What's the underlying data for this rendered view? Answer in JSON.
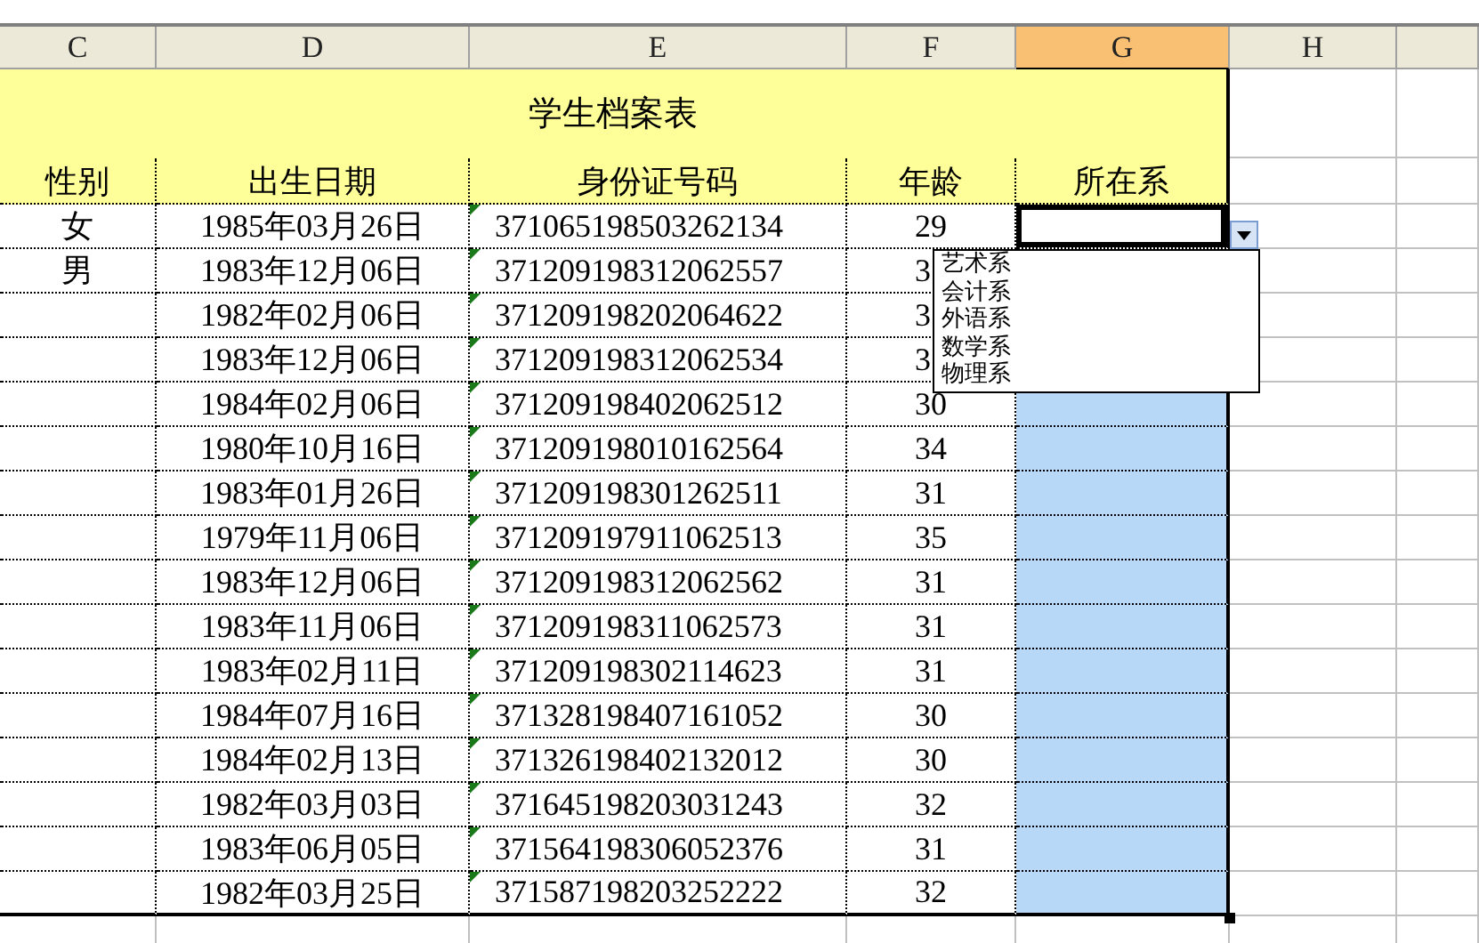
{
  "column_headers": [
    {
      "label": "C",
      "selected": false
    },
    {
      "label": "D",
      "selected": false
    },
    {
      "label": "E",
      "selected": false
    },
    {
      "label": "F",
      "selected": false
    },
    {
      "label": "G",
      "selected": true
    },
    {
      "label": "H",
      "selected": false
    }
  ],
  "title": "学生档案表",
  "table": {
    "columns": [
      "性别",
      "出生日期",
      "身份证号码",
      "年龄",
      "所在系"
    ],
    "rows": [
      {
        "gender": "女",
        "birth_date": "1985年03月26日",
        "id_number": "371065198503262134",
        "flagged": true,
        "age": "29",
        "selected": false,
        "active": true
      },
      {
        "gender": "男",
        "birth_date": "1983年12月06日",
        "id_number": "371209198312062557",
        "flagged": true,
        "age": "3"
      },
      {
        "birth_date": "1982年02月06日",
        "id_number": "371209198202064622",
        "flagged": true,
        "age": "3"
      },
      {
        "birth_date": "1983年12月06日",
        "id_number": "371209198312062534",
        "flagged": true,
        "age": "3"
      },
      {
        "birth_date": "1984年02月06日",
        "id_number": "371209198402062512",
        "flagged": true,
        "age": "30",
        "selected": true,
        "active": false
      },
      {
        "birth_date": "1980年10月16日",
        "id_number": "371209198010162564",
        "flagged": true,
        "age": "34",
        "selected": true,
        "active": false
      },
      {
        "birth_date": "1983年01月26日",
        "id_number": "371209198301262511",
        "flagged": true,
        "age": "31",
        "selected": true,
        "active": false
      },
      {
        "birth_date": "1979年11月06日",
        "id_number": "371209197911062513",
        "flagged": true,
        "age": "35",
        "selected": true,
        "active": false
      },
      {
        "birth_date": "1983年12月06日",
        "id_number": "371209198312062562",
        "flagged": true,
        "age": "31",
        "selected": true,
        "active": false
      },
      {
        "birth_date": "1983年11月06日",
        "id_number": "371209198311062573",
        "flagged": true,
        "age": "31",
        "selected": true,
        "active": false
      },
      {
        "birth_date": "1983年02月11日",
        "id_number": "371209198302114623",
        "flagged": true,
        "age": "31",
        "selected": true,
        "active": false
      },
      {
        "birth_date": "1984年07月16日",
        "id_number": "371328198407161052",
        "flagged": true,
        "age": "30",
        "selected": true,
        "active": false
      },
      {
        "birth_date": "1984年02月13日",
        "id_number": "371326198402132012",
        "flagged": true,
        "age": "30",
        "selected": true,
        "active": false
      },
      {
        "birth_date": "1982年03月03日",
        "id_number": "371645198203031243",
        "flagged": true,
        "age": "32",
        "selected": true,
        "active": false
      },
      {
        "birth_date": "1983年06月05日",
        "id_number": "371564198306052376",
        "flagged": true,
        "age": "31",
        "selected": true,
        "active": false
      },
      {
        "birth_date": "1982年03月25日",
        "id_number": "371587198203252222",
        "flagged": true,
        "age": "32",
        "selected": true,
        "active": false
      }
    ]
  },
  "dropdown": {
    "items": [
      "艺术系",
      "会计系",
      "外语系",
      "数学系",
      "物理系"
    ]
  }
}
